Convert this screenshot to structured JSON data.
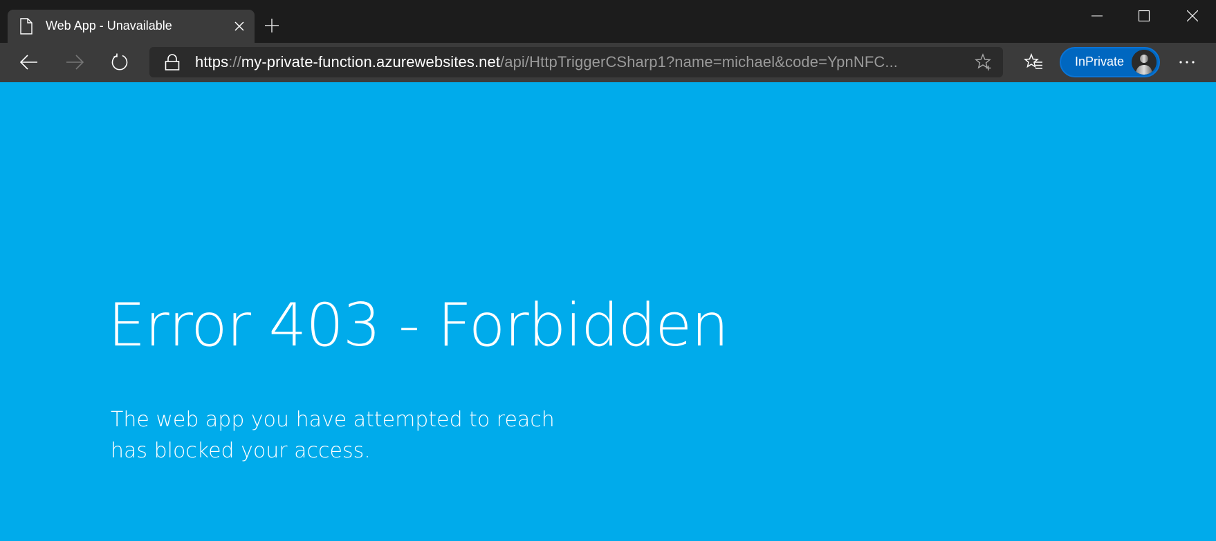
{
  "browser": {
    "tab": {
      "title": "Web App - Unavailable",
      "icon": "page-icon"
    },
    "new_tab_icon": "plus-icon",
    "window_controls": [
      "minimize-icon",
      "maximize-icon",
      "close-icon"
    ],
    "nav": {
      "back_icon": "arrow-left-icon",
      "forward_icon": "arrow-right-icon",
      "forward_enabled": false,
      "reload_icon": "refresh-icon"
    },
    "address_bar": {
      "lock_icon": "lock-icon",
      "scheme": "https",
      "separator": "://",
      "host": "my-private-function.azurewebsites.net",
      "path": "/api/HttpTriggerCSharp1?name=michael&code=YpnNFC...",
      "add_favorite_icon": "star-plus-icon"
    },
    "favorites_icon": "favorites-list-icon",
    "profile": {
      "label": "InPrivate",
      "avatar_icon": "person-icon",
      "accent": "#0067c0"
    },
    "more_icon": "ellipsis-icon"
  },
  "page": {
    "background": "#00abeb",
    "title": "Error 403 - Forbidden",
    "description": "The web app you have attempted to reach has blocked your access."
  }
}
